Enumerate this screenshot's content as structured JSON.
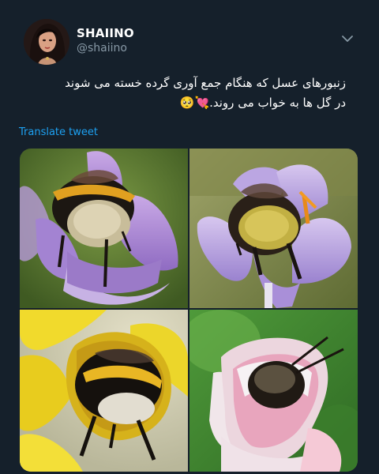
{
  "user": {
    "name": "SHAIINO",
    "handle": "@shaiino"
  },
  "tweet": {
    "line1": "زنبورهای عسل که هنگام جمع آوری گرده خسته می شوند",
    "line2": "در گل ها به خواب می روند.💘🥺"
  },
  "translate_label": "Translate tweet",
  "colors": {
    "background": "#15202b",
    "link": "#1da1f2",
    "secondary_text": "#8899a6"
  },
  "icons": {
    "menu": "chevron-down-icon"
  }
}
